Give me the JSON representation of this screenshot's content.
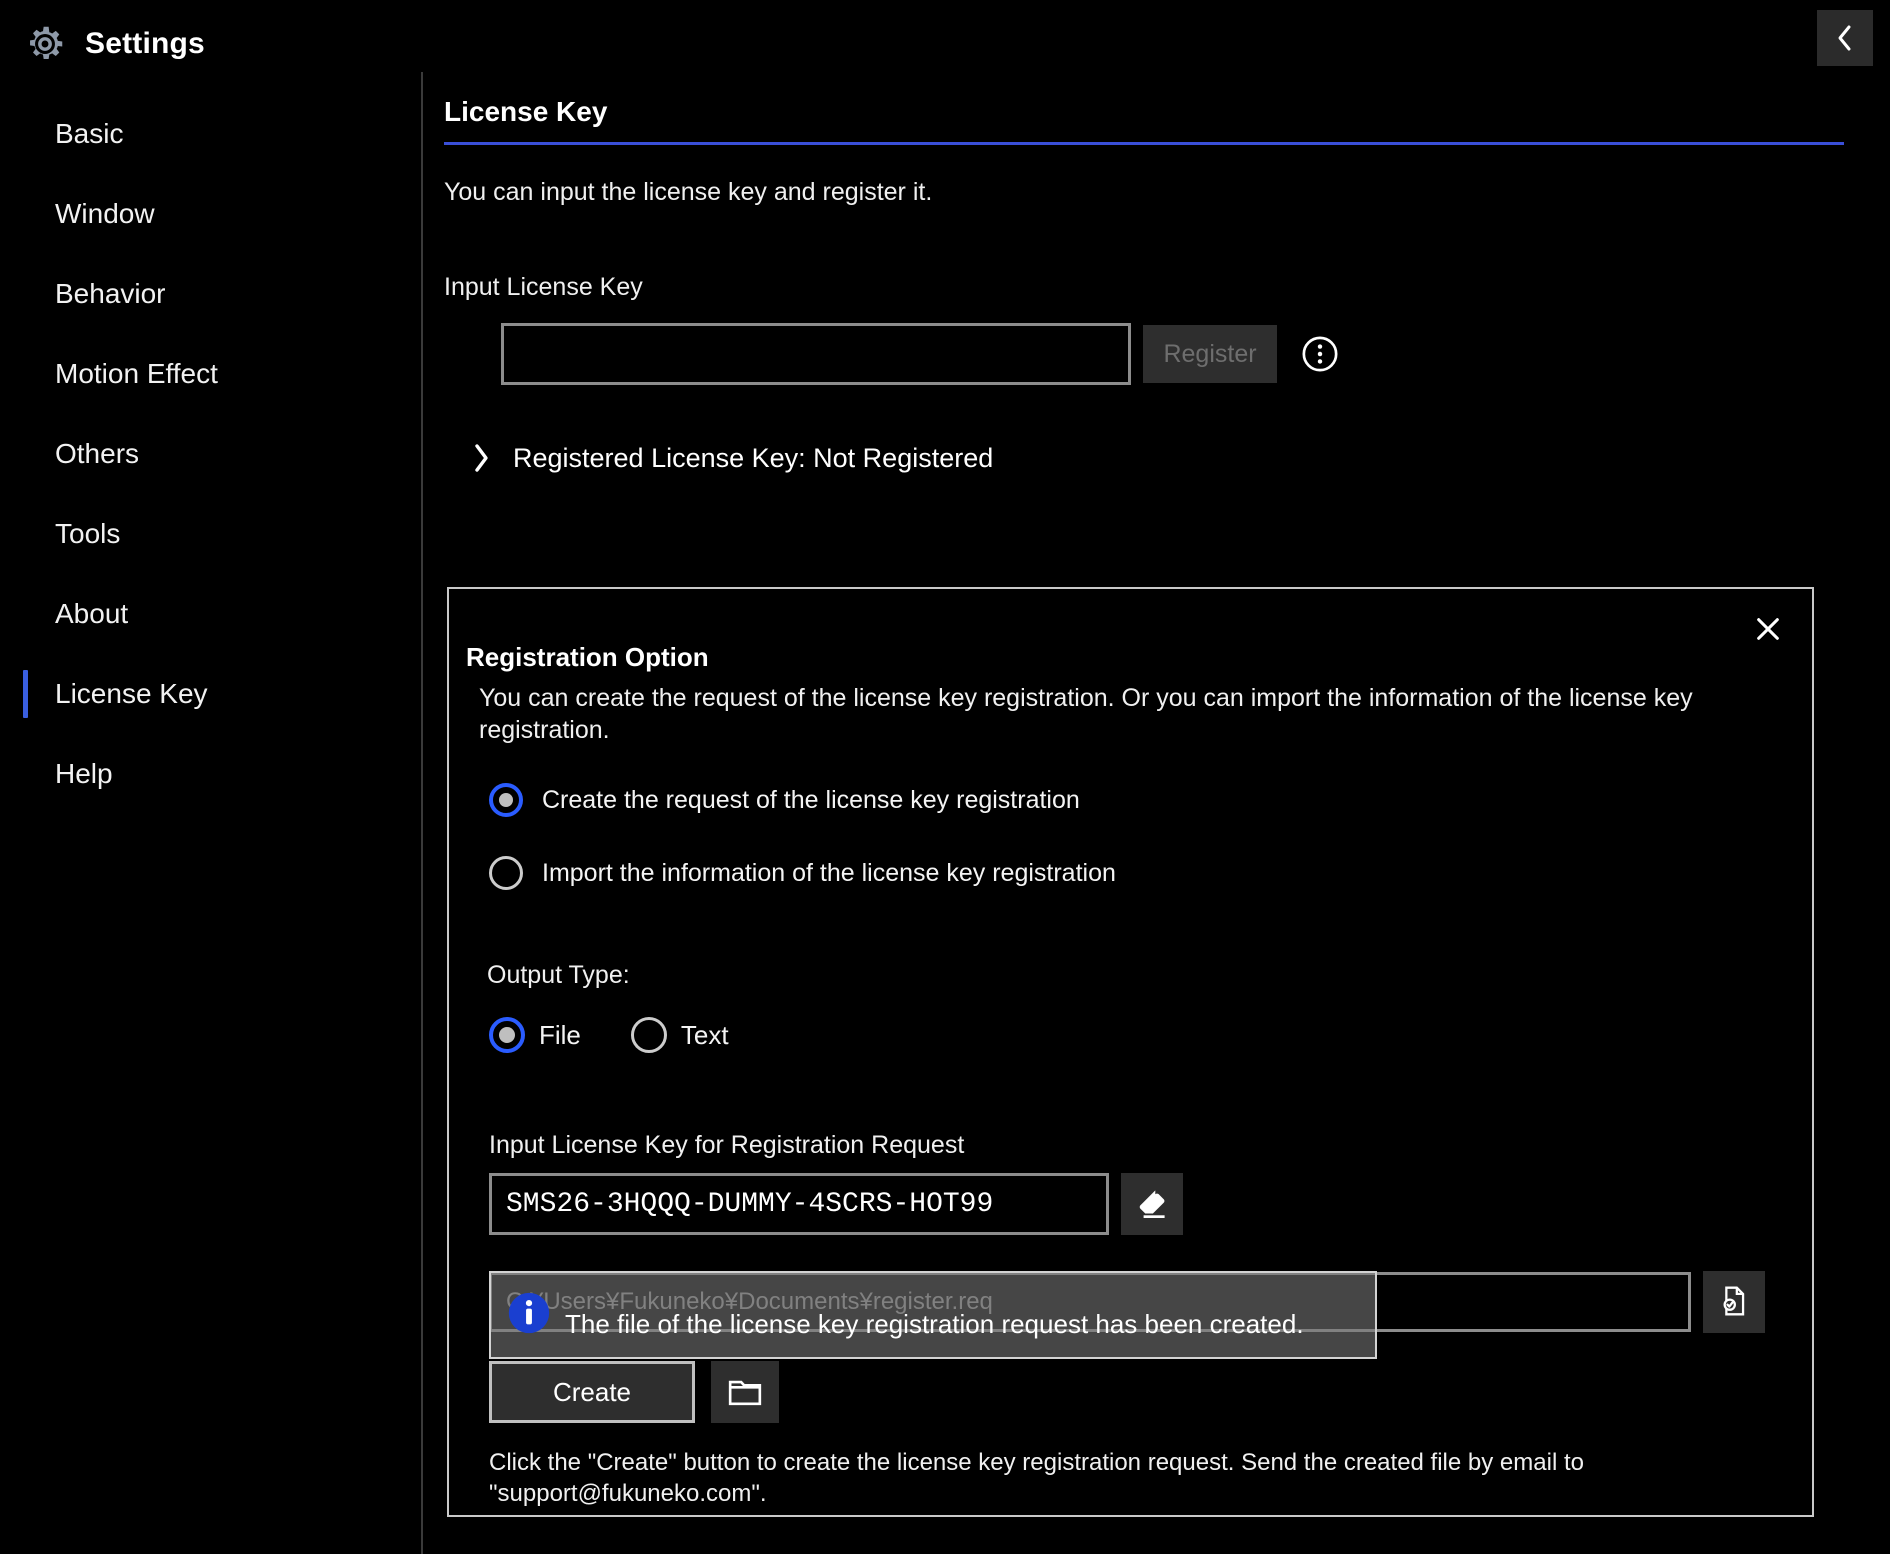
{
  "app": {
    "title": "Settings",
    "gear_icon": "gear-icon",
    "collapse_icon": "chevron-left-icon"
  },
  "sidebar": {
    "items": [
      {
        "label": "Basic",
        "active": false
      },
      {
        "label": "Window",
        "active": false
      },
      {
        "label": "Behavior",
        "active": false
      },
      {
        "label": "Motion Effect",
        "active": false
      },
      {
        "label": "Others",
        "active": false
      },
      {
        "label": "Tools",
        "active": false
      },
      {
        "label": "About",
        "active": false
      },
      {
        "label": "License Key",
        "active": true
      },
      {
        "label": "Help",
        "active": false
      }
    ],
    "accent_color": "#3a5fe0"
  },
  "page": {
    "title": "License Key",
    "rule_color": "#3a4fd8",
    "description": "You can input the license key and register it.",
    "license_input_label": "Input License Key",
    "license_input_value": "",
    "license_input_placeholder": "",
    "register_button": "Register",
    "register_button_enabled": false,
    "more_icon": "vertical-dots-circle-icon",
    "registered_status": "Registered License Key: Not Registered",
    "expand_icon": "chevron-right-icon"
  },
  "dialog": {
    "title": "Registration Option",
    "close_icon": "close-icon",
    "description": "You can create the request of the license key registration. Or you can import the information of the license key registration.",
    "mode_options": [
      {
        "label": "Create the request of the license key registration",
        "selected": true
      },
      {
        "label": "Import the information of the license key registration",
        "selected": false
      }
    ],
    "output_type_label": "Output Type:",
    "output_type_options": [
      {
        "label": "File",
        "selected": true
      },
      {
        "label": "Text",
        "selected": false
      }
    ],
    "request_key_label": "Input License Key for Registration Request",
    "request_key_value": "SMS26-3HQQQ-DUMMY-4SCRS-HOT99",
    "clear_icon": "eraser-icon",
    "output_path_value": "C:¥Users¥Fukuneko¥Documents¥register.req",
    "verify_icon": "document-check-icon",
    "create_button": "Create",
    "browse_icon": "folder-icon",
    "footnote": "Click the \"Create\" button to create the license key registration request. Send the created file by email to \"support@fukuneko.com\".",
    "selected_radio_color": "#2a5cff"
  },
  "toast": {
    "icon": "info-circle-icon",
    "message": "The file of the license key registration request has been created.",
    "icon_color": "#1a3fd0"
  }
}
